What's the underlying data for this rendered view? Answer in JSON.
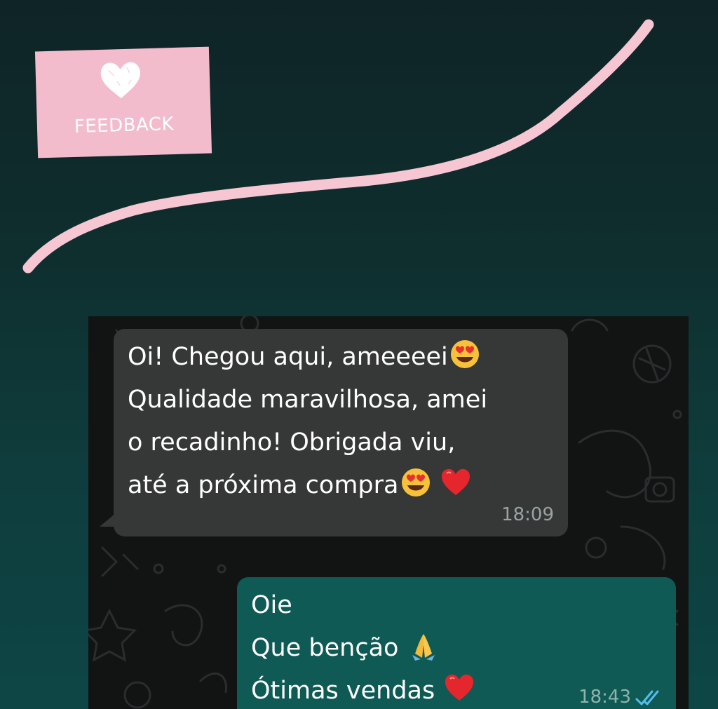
{
  "sticker": {
    "label": "FEEDBACK",
    "icon": "heart-icon",
    "color": "#f2bccd"
  },
  "decoration": {
    "swoosh_color": "#f6c7d3"
  },
  "chat": {
    "incoming": {
      "lines": [
        "Oi! Chegou aqui, ameeeei",
        "Qualidade maravilhosa, amei",
        "o recadinho! Obrigada viu,",
        "até a próxima compra"
      ],
      "time": "18:09",
      "emojis": [
        "heart-eyes-emoji",
        "heart-eyes-emoji",
        "red-heart-emoji"
      ]
    },
    "outgoing": {
      "lines": [
        "Oie",
        "Que benção",
        "Ótimas vendas"
      ],
      "time": "18:43",
      "status": "double-check-icon",
      "emojis": [
        "folded-hands-emoji",
        "red-heart-emoji"
      ]
    },
    "colors": {
      "incoming_bubble": "#363838",
      "outgoing_bubble": "#0f5a55",
      "read_ticks": "#53bdeb"
    }
  }
}
